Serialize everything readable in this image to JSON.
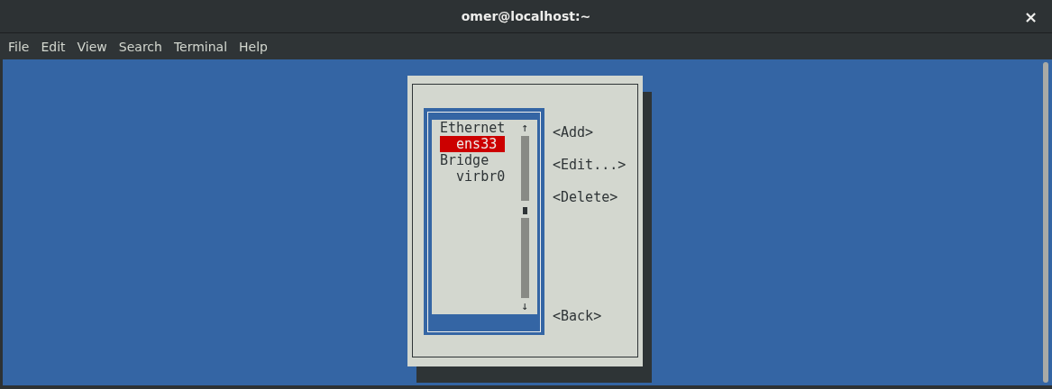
{
  "window": {
    "title": "omer@localhost:~",
    "close": "×"
  },
  "menu": [
    "File",
    "Edit",
    "View",
    "Search",
    "Terminal",
    "Help"
  ],
  "connections": [
    {
      "label": "Ethernet",
      "children": [
        {
          "label": "ens33",
          "selected": true
        }
      ]
    },
    {
      "label": "Bridge",
      "children": [
        {
          "label": "virbr0",
          "selected": false
        }
      ]
    }
  ],
  "list_scroll": {
    "up": "↑",
    "down": "↓"
  },
  "actions": [
    "<Add>",
    "<Edit...>",
    "<Delete>"
  ],
  "back": "<Back>"
}
